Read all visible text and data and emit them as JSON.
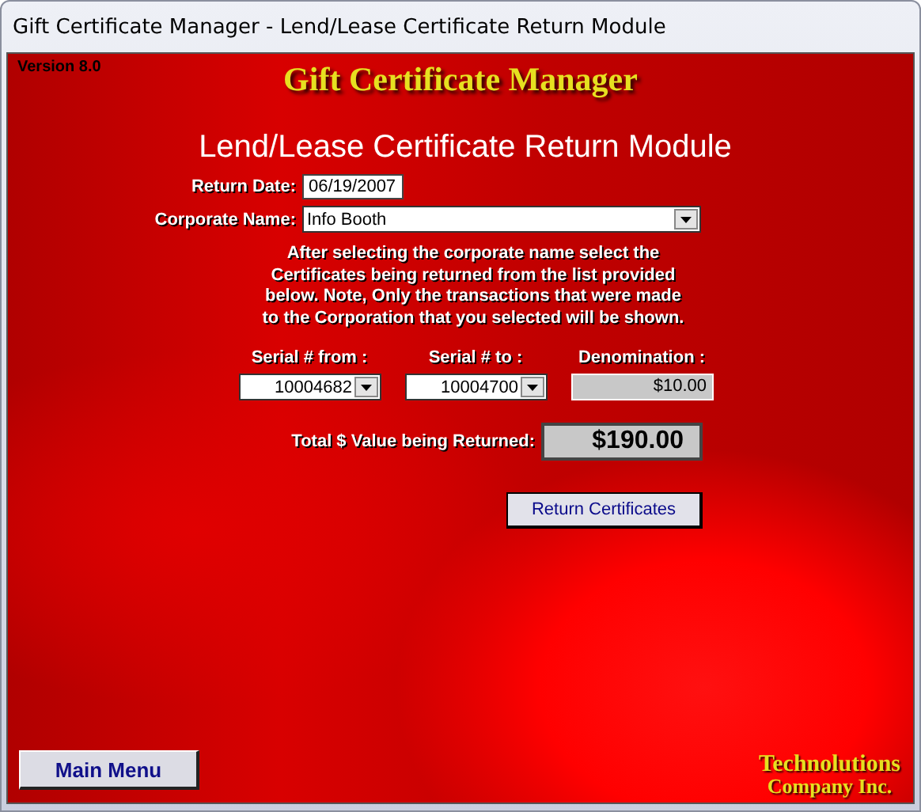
{
  "window": {
    "title": "Gift Certificate Manager - Lend/Lease Certificate Return Module"
  },
  "version": "Version 8.0",
  "app_title": "Gift Certificate Manager",
  "heading": "Lend/Lease Certificate Return Module",
  "return_date": {
    "label": "Return Date:",
    "value": "06/19/2007"
  },
  "corporate_name": {
    "label": "Corporate Name:",
    "value": "Info Booth"
  },
  "instructions": "After selecting the corporate name select the Certificates being returned from the list provided below.  Note, Only the transactions that were made to the Corporation that you selected will be shown.",
  "serial_from": {
    "label": "Serial # from :",
    "value": "10004682"
  },
  "serial_to": {
    "label": "Serial # to :",
    "value": "10004700"
  },
  "denomination": {
    "label": "Denomination :",
    "value": "$10.00"
  },
  "total": {
    "label": "Total $ Value being Returned:",
    "value": "$190.00"
  },
  "return_button": "Return Certificates",
  "main_menu_button": "Main Menu",
  "company": {
    "line1": "Technolutions",
    "line2": "Company Inc."
  }
}
